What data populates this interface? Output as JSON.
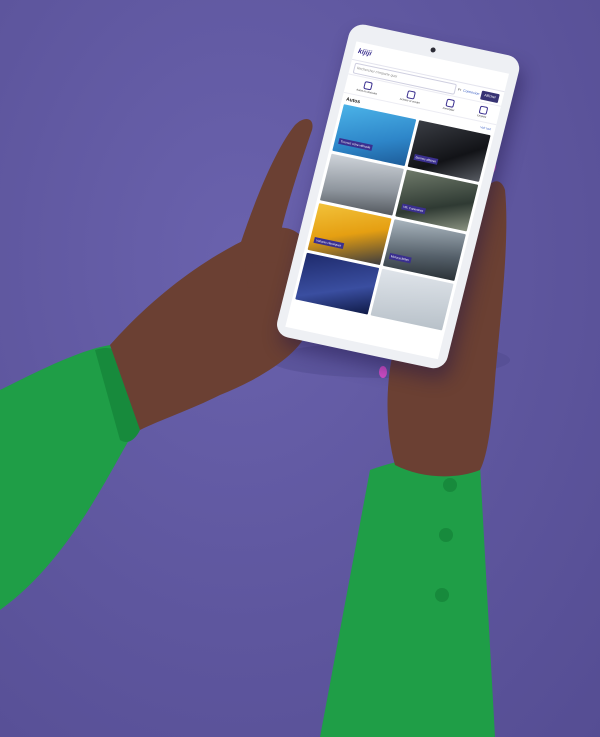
{
  "scene": {
    "colors": {
      "background": "#5f579f",
      "sleeve": "#1f9e47",
      "skin": "#6b4033",
      "nails": "#d24ec8",
      "tablet": "#eef0f4"
    }
  },
  "tablet_screen": {
    "logo": "kijiji",
    "search_placeholder": "Rechercher n'importe quoi",
    "flag": "Fr",
    "connect_link": "Connexion",
    "post_button": "Afficher",
    "categories": [
      {
        "icon": "car-icon",
        "label": "Autos et véhicules"
      },
      {
        "icon": "tag-icon",
        "label": "Acheter et vendre"
      },
      {
        "icon": "home-icon",
        "label": "Immobilier"
      },
      {
        "icon": "briefcase-icon",
        "label": "Emplois"
      }
    ],
    "section_title": "Autos",
    "section_link": "Voir tout",
    "tiles": [
      {
        "label": "Trouvez votre véhicule"
      },
      {
        "label": "Bonnes affaires"
      },
      {
        "label": ""
      },
      {
        "label": "VR, Caravanes"
      },
      {
        "label": "Voitures classiques"
      },
      {
        "label": "Motocyclettes"
      },
      {
        "label": ""
      },
      {
        "label": ""
      }
    ]
  }
}
